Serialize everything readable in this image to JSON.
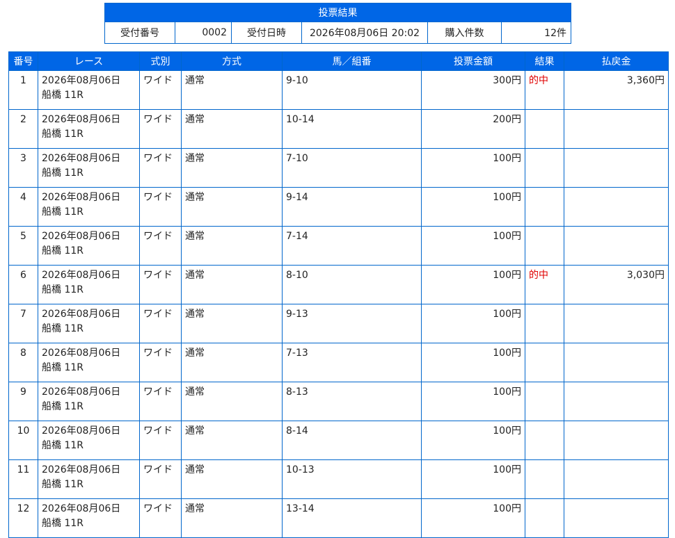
{
  "summary": {
    "title": "投票結果",
    "receipt_no_label": "受付番号",
    "receipt_no": "0002",
    "receipt_time_label": "受付日時",
    "receipt_time": "2026年08月06日 20:02",
    "count_label": "購入件数",
    "count": "12件"
  },
  "table": {
    "headers": [
      "番号",
      "レース",
      "式別",
      "方式",
      "馬／組番",
      "投票金額",
      "結果",
      "払戻金"
    ],
    "rows": [
      {
        "no": "1",
        "date": "2026年08月06日",
        "race": "船橋 11R",
        "type": "ワイド",
        "method": "通常",
        "combo": "9-10",
        "amount": "300円",
        "result": "的中",
        "payout": "3,360円"
      },
      {
        "no": "2",
        "date": "2026年08月06日",
        "race": "船橋 11R",
        "type": "ワイド",
        "method": "通常",
        "combo": "10-14",
        "amount": "200円",
        "result": "",
        "payout": ""
      },
      {
        "no": "3",
        "date": "2026年08月06日",
        "race": "船橋 11R",
        "type": "ワイド",
        "method": "通常",
        "combo": "7-10",
        "amount": "100円",
        "result": "",
        "payout": ""
      },
      {
        "no": "4",
        "date": "2026年08月06日",
        "race": "船橋 11R",
        "type": "ワイド",
        "method": "通常",
        "combo": "9-14",
        "amount": "100円",
        "result": "",
        "payout": ""
      },
      {
        "no": "5",
        "date": "2026年08月06日",
        "race": "船橋 11R",
        "type": "ワイド",
        "method": "通常",
        "combo": "7-14",
        "amount": "100円",
        "result": "",
        "payout": ""
      },
      {
        "no": "6",
        "date": "2026年08月06日",
        "race": "船橋 11R",
        "type": "ワイド",
        "method": "通常",
        "combo": "8-10",
        "amount": "100円",
        "result": "的中",
        "payout": "3,030円"
      },
      {
        "no": "7",
        "date": "2026年08月06日",
        "race": "船橋 11R",
        "type": "ワイド",
        "method": "通常",
        "combo": "9-13",
        "amount": "100円",
        "result": "",
        "payout": ""
      },
      {
        "no": "8",
        "date": "2026年08月06日",
        "race": "船橋 11R",
        "type": "ワイド",
        "method": "通常",
        "combo": "7-13",
        "amount": "100円",
        "result": "",
        "payout": ""
      },
      {
        "no": "9",
        "date": "2026年08月06日",
        "race": "船橋 11R",
        "type": "ワイド",
        "method": "通常",
        "combo": "8-13",
        "amount": "100円",
        "result": "",
        "payout": ""
      },
      {
        "no": "10",
        "date": "2026年08月06日",
        "race": "船橋 11R",
        "type": "ワイド",
        "method": "通常",
        "combo": "8-14",
        "amount": "100円",
        "result": "",
        "payout": ""
      },
      {
        "no": "11",
        "date": "2026年08月06日",
        "race": "船橋 11R",
        "type": "ワイド",
        "method": "通常",
        "combo": "10-13",
        "amount": "100円",
        "result": "",
        "payout": ""
      },
      {
        "no": "12",
        "date": "2026年08月06日",
        "race": "船橋 11R",
        "type": "ワイド",
        "method": "通常",
        "combo": "13-14",
        "amount": "100円",
        "result": "",
        "payout": ""
      }
    ]
  },
  "colors": {
    "header_bg": "#0066e6",
    "border": "#0066cc",
    "hit_text": "#e00000"
  }
}
